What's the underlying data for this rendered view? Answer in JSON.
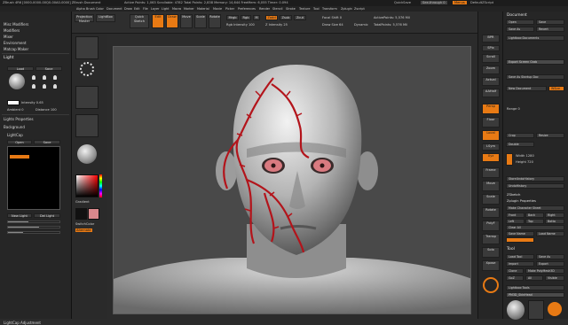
{
  "window": {
    "title": "ZBrush 4R6 [0000-0000-00Q0-00A0-0000]   ZBrush Document",
    "status_text": "Active Points: 1,063   Scrollable: 4782   Total Points: 2,838   Memory: 14,644   FreeMem: 6,055   Timer: 0.094",
    "quicksave": "QuickSave",
    "see_through": "See-through 0",
    "menus_label": "Menus",
    "default_script": "DefaultZScript"
  },
  "menu_items": [
    "Alpha",
    "Brush",
    "Color",
    "Document",
    "Draw",
    "Edit",
    "File",
    "Layer",
    "Light",
    "Macro",
    "Marker",
    "Material",
    "Movie",
    "Picker",
    "Preferences",
    "Render",
    "Stencil",
    "Stroke",
    "Texture",
    "Tool",
    "Transform",
    "Zplugin",
    "Zscript"
  ],
  "left_panel": {
    "items": [
      "Misc Modifiers",
      "Modifiers",
      "Mixer",
      "Environment",
      "Matcap Maker"
    ],
    "light_header": "Light",
    "light_tabs": [
      "Load",
      "Save"
    ],
    "intensity_label": "Intensity 0.65",
    "ambient_label": "Ambient 0",
    "distance_label": "Distance 100",
    "lights_properties": "Lights Properties",
    "background": "Background",
    "lightcap": "LightCap",
    "lightcap_tabs": [
      "Open",
      "Save"
    ],
    "lightcap_btns": [
      "New Light",
      "Del Light"
    ],
    "adjustment": "LightCap Adjustment"
  },
  "toolshelf": {
    "projection_master": "Projection Master",
    "lightbox": "LightBox",
    "gradient": "Gradient",
    "switch_color": "SwitchColor",
    "alternate": "Alternate"
  },
  "topbar": {
    "quick_sketch": "Quick Sketch",
    "edit": "Edit",
    "draw": "Draw",
    "move": "Move",
    "scale": "Scale",
    "rotate": "Rotate",
    "mrgb": "Mrgb",
    "rgb": "Rgb",
    "m": "M",
    "zadd": "Zadd",
    "zsub": "Zsub",
    "zcut": "Zcut",
    "focal_shift": "Focal Shift 0",
    "draw_size": "Draw Size 64",
    "dynamic": "Dynamic",
    "rgb_intensity": "Rgb Intensity 100",
    "z_intensity": "Z Intensity 25",
    "active_points": "ActivePoints: 5,576 Mil",
    "total_points": "TotalPoints: 5,576 Mil"
  },
  "right_shelf": {
    "icons": [
      "BPR",
      "SPix",
      "Scroll",
      "Zoom",
      "Actual",
      "AAHalf",
      "Persp",
      "Floor",
      "Local",
      "LSym",
      "Xyz",
      "Frame",
      "Move",
      "Scale",
      "Rotate",
      "PolyF",
      "Transp",
      "Solo",
      "Xpose"
    ]
  },
  "right_panel": {
    "title": "Document",
    "open": "Open",
    "save": "Save",
    "save_as": "Save As",
    "revert": "Revert",
    "lightbox_documents": "Lightbox›Documents",
    "export_screen_grab": "Export Screen Grab",
    "save_startup": "Save As Startup Doc",
    "new_document": "New Document",
    "wsize": "WSize",
    "range": "Range 0",
    "crop": "Crop",
    "resize": "Resize",
    "double": "Double",
    "width": "Width 1280",
    "height": "Height 720",
    "storeundo": "StoreUndoHistory",
    "undohistory": "UndoHistory",
    "zsketch": "ZSketch",
    "zplugin_props": "Zplugin Properties",
    "make_char_sheet": "Make Character Sheet",
    "front": "Front",
    "back": "Back",
    "right": "Right",
    "left": "Left",
    "top": "Top",
    "bottom": "Botto",
    "clear_all": "Clear All",
    "save_name": "Save Name",
    "load_name": "Load Name",
    "tool_title": "Tool",
    "load_tool": "Load Tool",
    "save_as2": "Save As",
    "import": "Import",
    "export": "Export",
    "clone": "Clone",
    "make_polymesh": "Make PolyMesh3D",
    "goz": "GoZ",
    "all": "All",
    "visible": "Visible",
    "lightbox_tools": "Lightbox›Tools",
    "tool_name": "PM3D_SkinHead",
    "mrgb_label": "Mrgb",
    "stroke_label": "Stroke"
  },
  "colors": {
    "accent_orange": "#e87a14",
    "panel": "#262626",
    "canvas": "#494949"
  }
}
